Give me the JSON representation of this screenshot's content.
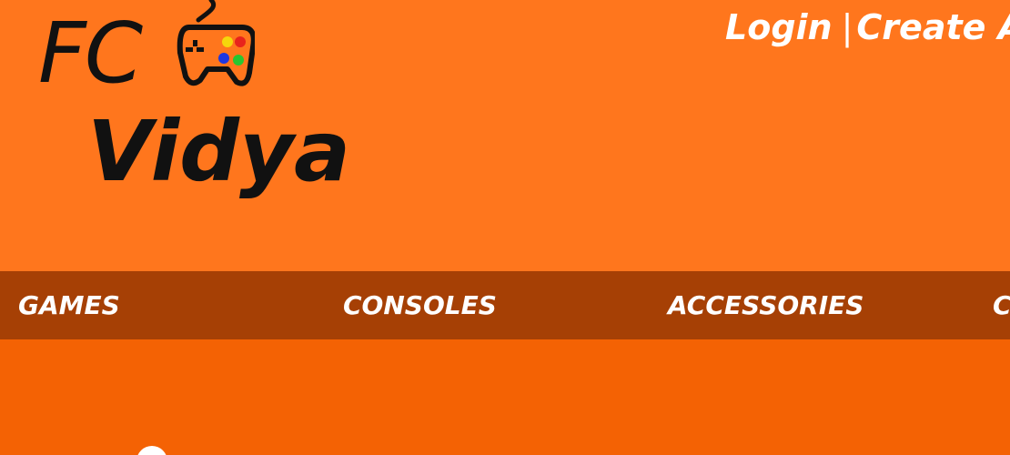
{
  "brand": {
    "logo_line1": "FC",
    "logo_line2": "Vidya",
    "logo_icon": "gamepad-icon"
  },
  "account": {
    "login_label": "Login",
    "separator": "|",
    "create_label": "Create Account"
  },
  "nav": {
    "items": [
      {
        "label": "GAMES"
      },
      {
        "label": "CONSOLES"
      },
      {
        "label": "ACCESSORIES"
      },
      {
        "label": "COLLECTIBLES"
      }
    ]
  },
  "colors": {
    "header_bg": "#ff761d",
    "nav_bg": "#a64005",
    "content_bg": "#f46204",
    "text_light": "#ffffff",
    "logo_text": "#111111"
  }
}
